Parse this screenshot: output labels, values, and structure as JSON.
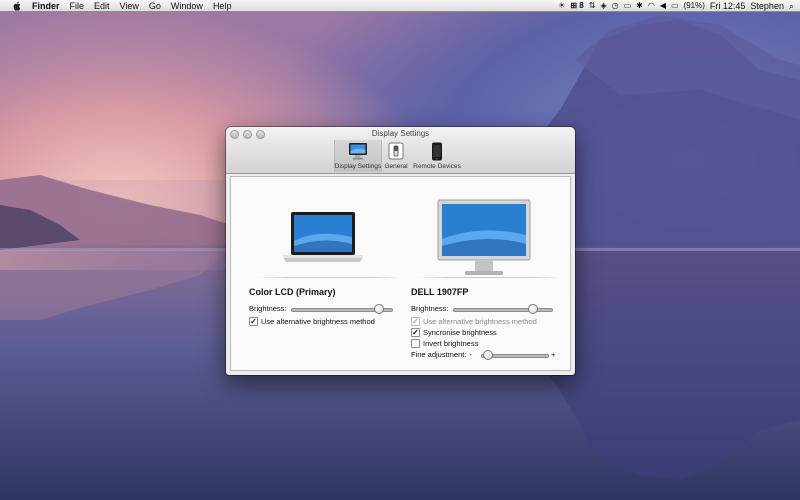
{
  "menubar": {
    "app_name": "Finder",
    "menus": [
      "File",
      "Edit",
      "View",
      "Go",
      "Window",
      "Help"
    ],
    "status": {
      "spaces_count": "8",
      "battery": "(91%)",
      "clock": "Fri 12:45",
      "user": "Stephen"
    }
  },
  "window": {
    "title": "Display Settings",
    "toolbar": [
      {
        "label": "Display Settings",
        "icon": "display-icon",
        "selected": true
      },
      {
        "label": "General",
        "icon": "switch-icon",
        "selected": false
      },
      {
        "label": "Remote Devices",
        "icon": "phone-icon",
        "selected": false
      }
    ]
  },
  "displays": {
    "primary": {
      "name": "Color LCD (Primary)",
      "brightness_label": "Brightness:",
      "brightness_level": 0.88,
      "alt_method_label": "Use alternative brightness method",
      "alt_method_checked": true
    },
    "secondary": {
      "name": "DELL 1907FP",
      "brightness_label": "Brightness:",
      "brightness_level": 0.82,
      "alt_method_label": "Use alternative brightness method",
      "alt_method_checked": true,
      "alt_method_enabled": false,
      "sync_label": "Syncronise brightness",
      "sync_checked": true,
      "invert_label": "Invert brightness",
      "invert_checked": false,
      "fine_label": "Fine adjustment:",
      "fine_minus": "-",
      "fine_plus": "+",
      "fine_level": 0.1
    }
  },
  "colors": {
    "accent_blue": "#3a8fd8",
    "window_bg": "#ececec"
  }
}
